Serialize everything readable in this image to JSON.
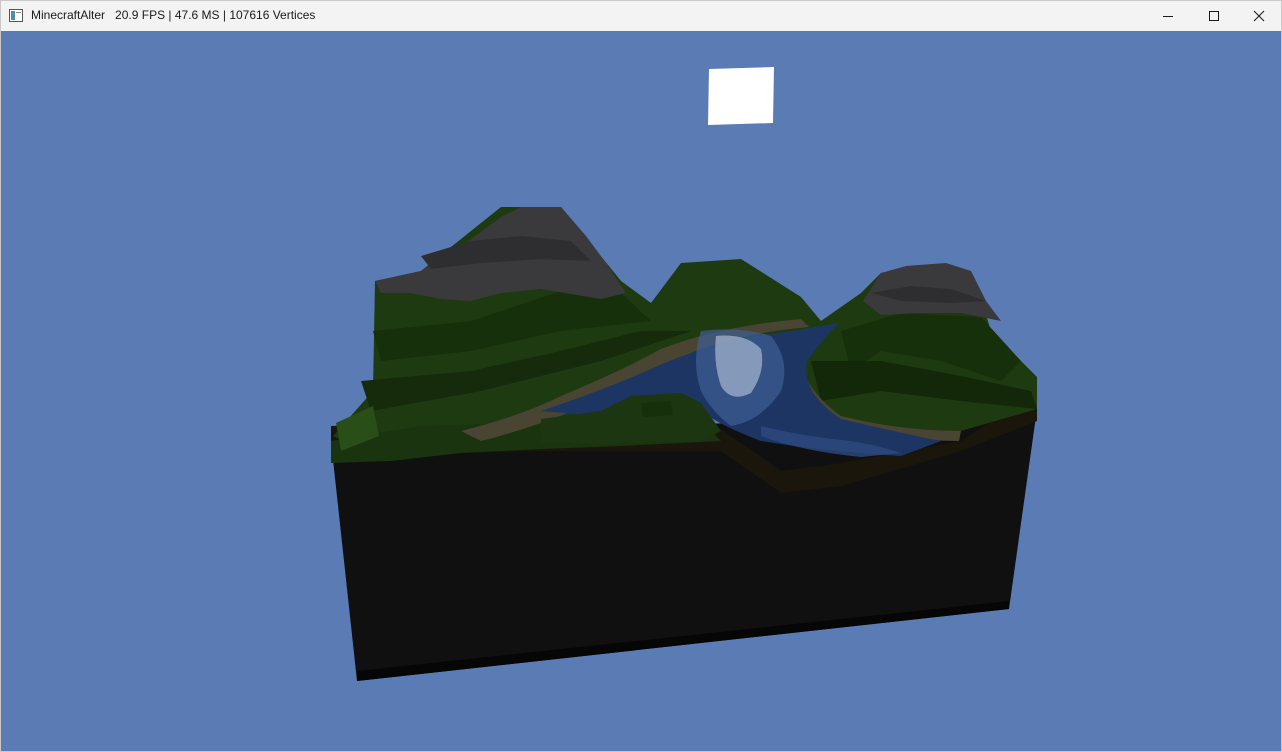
{
  "window": {
    "app_name": "MinecraftAlter",
    "stats": "20.9 FPS | 47.6 MS | 107616 Vertices"
  },
  "controls": {
    "minimize": "minimize",
    "maximize": "maximize",
    "close": "close"
  },
  "scene": {
    "sky_color": "#5b7bb5",
    "sun_color": "#ffffff",
    "grass_color": "#1d3a10",
    "stone_color": "#3a3a3c",
    "water_color": "#1c3563",
    "dirt_color": "#0f0f0f",
    "sand_color": "#4a4532"
  }
}
